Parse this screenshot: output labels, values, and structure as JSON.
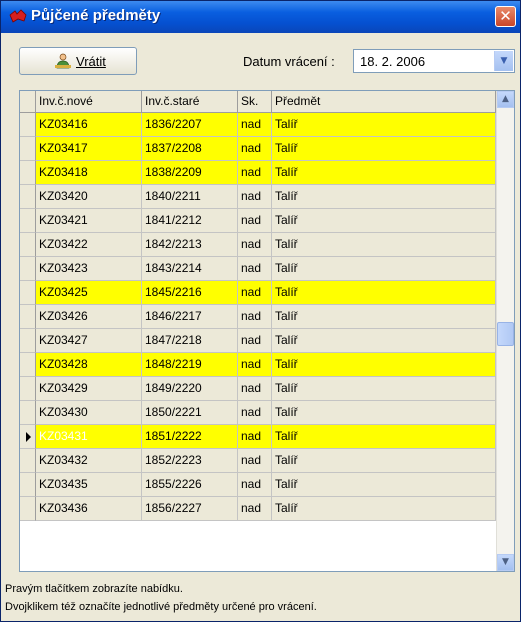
{
  "window": {
    "title": "Půjčené předměty",
    "close_symbol": "✕"
  },
  "toolbar": {
    "return_label": "Vrátit",
    "date_label": "Datum vrácení :",
    "date_value": "18. 2. 2006"
  },
  "grid": {
    "columns": [
      "Inv.č.nové",
      "Inv.č.staré",
      "Sk.",
      "Předmět"
    ],
    "rows": [
      {
        "inv_new": "KZ03416",
        "inv_old": "1836/2207",
        "sk": "nad",
        "item": "Talíř",
        "highlight": true
      },
      {
        "inv_new": "KZ03417",
        "inv_old": "1837/2208",
        "sk": "nad",
        "item": "Talíř",
        "highlight": true
      },
      {
        "inv_new": "KZ03418",
        "inv_old": "1838/2209",
        "sk": "nad",
        "item": "Talíř",
        "highlight": true
      },
      {
        "inv_new": "KZ03420",
        "inv_old": "1840/2211",
        "sk": "nad",
        "item": "Talíř",
        "highlight": false
      },
      {
        "inv_new": "KZ03421",
        "inv_old": "1841/2212",
        "sk": "nad",
        "item": "Talíř",
        "highlight": false
      },
      {
        "inv_new": "KZ03422",
        "inv_old": "1842/2213",
        "sk": "nad",
        "item": "Talíř",
        "highlight": false
      },
      {
        "inv_new": "KZ03423",
        "inv_old": "1843/2214",
        "sk": "nad",
        "item": "Talíř",
        "highlight": false
      },
      {
        "inv_new": "KZ03425",
        "inv_old": "1845/2216",
        "sk": "nad",
        "item": "Talíř",
        "highlight": true
      },
      {
        "inv_new": "KZ03426",
        "inv_old": "1846/2217",
        "sk": "nad",
        "item": "Talíř",
        "highlight": false
      },
      {
        "inv_new": "KZ03427",
        "inv_old": "1847/2218",
        "sk": "nad",
        "item": "Talíř",
        "highlight": false
      },
      {
        "inv_new": "KZ03428",
        "inv_old": "1848/2219",
        "sk": "nad",
        "item": "Talíř",
        "highlight": true
      },
      {
        "inv_new": "KZ03429",
        "inv_old": "1849/2220",
        "sk": "nad",
        "item": "Talíř",
        "highlight": false
      },
      {
        "inv_new": "KZ03430",
        "inv_old": "1850/2221",
        "sk": "nad",
        "item": "Talíř",
        "highlight": false
      },
      {
        "inv_new": "KZ03431",
        "inv_old": "1851/2222",
        "sk": "nad",
        "item": "Talíř",
        "highlight": true,
        "selected": true
      },
      {
        "inv_new": "KZ03432",
        "inv_old": "1852/2223",
        "sk": "nad",
        "item": "Talíř",
        "highlight": false
      },
      {
        "inv_new": "KZ03435",
        "inv_old": "1855/2226",
        "sk": "nad",
        "item": "Talíř",
        "highlight": false
      },
      {
        "inv_new": "KZ03436",
        "inv_old": "1856/2227",
        "sk": "nad",
        "item": "Talíř",
        "highlight": false
      }
    ]
  },
  "status": {
    "line1": "Pravým tlačítkem zobrazíte nabídku.",
    "line2": "Dvojklikem též označíte jednotlivé předměty určené pro vrácení."
  },
  "colors": {
    "highlight": "#ffff00",
    "normal": "#ece9d8",
    "selected": "#0a24b0"
  }
}
